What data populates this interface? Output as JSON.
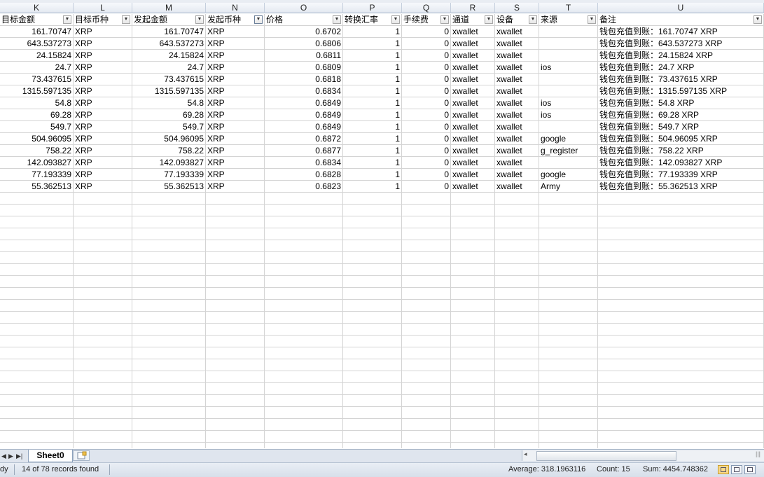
{
  "columns": [
    "K",
    "L",
    "M",
    "N",
    "O",
    "P",
    "Q",
    "R",
    "S",
    "T",
    "U"
  ],
  "headers": [
    "目标金额",
    "目标币种",
    "发起金额",
    "发起币种",
    "价格",
    "转换汇率",
    "手续费",
    "通道",
    "设备",
    "来源",
    "备注"
  ],
  "rows": [
    [
      "161.70747",
      "XRP",
      "161.70747",
      "XRP",
      "0.6702",
      "1",
      "0",
      "xwallet",
      "xwallet",
      "",
      "钱包充值到账：161.70747 XRP"
    ],
    [
      "643.537273",
      "XRP",
      "643.537273",
      "XRP",
      "0.6806",
      "1",
      "0",
      "xwallet",
      "xwallet",
      "",
      "钱包充值到账：643.537273 XRP"
    ],
    [
      "24.15824",
      "XRP",
      "24.15824",
      "XRP",
      "0.6811",
      "1",
      "0",
      "xwallet",
      "xwallet",
      "",
      "钱包充值到账：24.15824 XRP"
    ],
    [
      "24.7",
      "XRP",
      "24.7",
      "XRP",
      "0.6809",
      "1",
      "0",
      "xwallet",
      "xwallet",
      "ios",
      "钱包充值到账：24.7 XRP"
    ],
    [
      "73.437615",
      "XRP",
      "73.437615",
      "XRP",
      "0.6818",
      "1",
      "0",
      "xwallet",
      "xwallet",
      "",
      "钱包充值到账：73.437615 XRP"
    ],
    [
      "1315.597135",
      "XRP",
      "1315.597135",
      "XRP",
      "0.6834",
      "1",
      "0",
      "xwallet",
      "xwallet",
      "",
      "钱包充值到账：1315.597135 XRP"
    ],
    [
      "54.8",
      "XRP",
      "54.8",
      "XRP",
      "0.6849",
      "1",
      "0",
      "xwallet",
      "xwallet",
      "ios",
      "钱包充值到账：54.8 XRP"
    ],
    [
      "69.28",
      "XRP",
      "69.28",
      "XRP",
      "0.6849",
      "1",
      "0",
      "xwallet",
      "xwallet",
      "ios",
      "钱包充值到账：69.28 XRP"
    ],
    [
      "549.7",
      "XRP",
      "549.7",
      "XRP",
      "0.6849",
      "1",
      "0",
      "xwallet",
      "xwallet",
      "",
      "钱包充值到账：549.7 XRP"
    ],
    [
      "504.96095",
      "XRP",
      "504.96095",
      "XRP",
      "0.6872",
      "1",
      "0",
      "xwallet",
      "xwallet",
      "google",
      "钱包充值到账：504.96095 XRP"
    ],
    [
      "758.22",
      "XRP",
      "758.22",
      "XRP",
      "0.6877",
      "1",
      "0",
      "xwallet",
      "xwallet",
      "g_register",
      "钱包充值到账：758.22 XRP"
    ],
    [
      "142.093827",
      "XRP",
      "142.093827",
      "XRP",
      "0.6834",
      "1",
      "0",
      "xwallet",
      "xwallet",
      "",
      "钱包充值到账：142.093827 XRP"
    ],
    [
      "77.193339",
      "XRP",
      "77.193339",
      "XRP",
      "0.6828",
      "1",
      "0",
      "xwallet",
      "xwallet",
      "google",
      "钱包充值到账：77.193339 XRP"
    ],
    [
      "55.362513",
      "XRP",
      "55.362513",
      "XRP",
      "0.6823",
      "1",
      "0",
      "xwallet",
      "xwallet",
      "Army",
      "钱包充值到账：55.362513 XRP"
    ]
  ],
  "tabs": {
    "sheet_name": "Sheet0"
  },
  "status": {
    "mode": "dy",
    "records": "14 of 78 records found",
    "average": "Average: 318.1963116",
    "count": "Count: 15",
    "sum": "Sum: 4454.748362"
  },
  "icons": {
    "filter": "filter-dropdown-icon",
    "filter_active": "filter-active-icon",
    "new_sheet": "new-sheet-icon"
  }
}
